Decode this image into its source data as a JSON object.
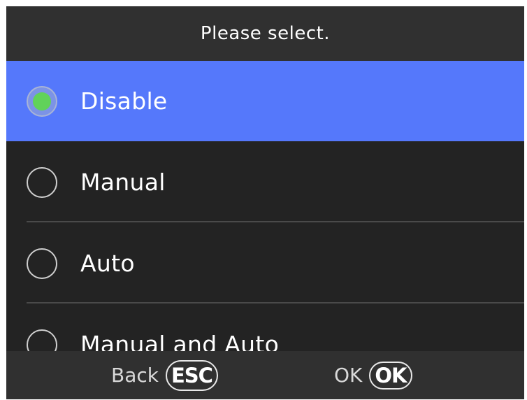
{
  "header": {
    "title": "Please select."
  },
  "options": [
    {
      "label": "Disable",
      "selected": true
    },
    {
      "label": "Manual",
      "selected": false
    },
    {
      "label": "Auto",
      "selected": false
    },
    {
      "label": "Manual and Auto",
      "selected": false
    }
  ],
  "footer": {
    "back_label": "Back",
    "back_key": "ESC",
    "ok_label": "OK",
    "ok_key": "OK"
  },
  "colors": {
    "selection_highlight": "#5578fb",
    "radio_selected_dot": "#61d25a",
    "background": "#232323",
    "bar_background": "#303030"
  }
}
